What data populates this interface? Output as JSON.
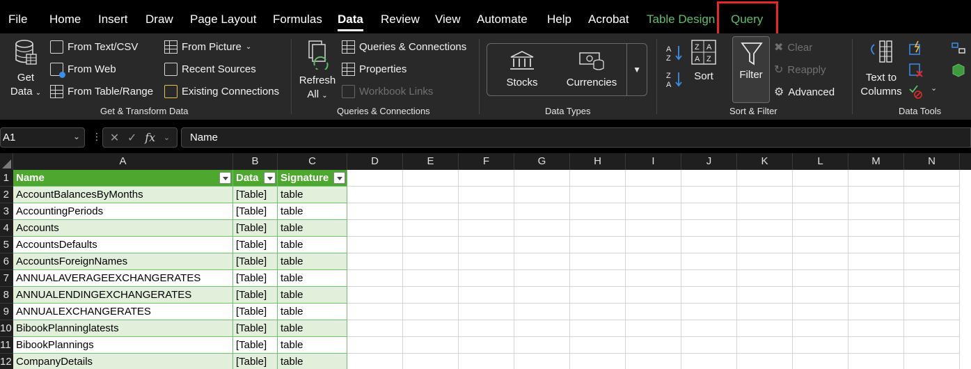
{
  "menu": {
    "tabs": [
      {
        "label": "File"
      },
      {
        "label": "Home"
      },
      {
        "label": "Insert"
      },
      {
        "label": "Draw"
      },
      {
        "label": "Page Layout"
      },
      {
        "label": "Formulas"
      },
      {
        "label": "Data"
      },
      {
        "label": "Review"
      },
      {
        "label": "View"
      },
      {
        "label": "Automate"
      },
      {
        "label": "Help"
      },
      {
        "label": "Acrobat"
      },
      {
        "label": "Table Design"
      },
      {
        "label": "Query"
      }
    ],
    "active_tab": "Data",
    "highlight_color": "#e4282a",
    "contextual_color": "#5fbe6a"
  },
  "ribbon": {
    "get_transform": {
      "get_data_line1": "Get",
      "get_data_line2": "Data",
      "from_text_csv": "From Text/CSV",
      "from_web": "From Web",
      "from_table_range": "From Table/Range",
      "from_picture": "From Picture",
      "recent_sources": "Recent Sources",
      "existing_connections": "Existing Connections",
      "group_label": "Get & Transform Data"
    },
    "queries_connections": {
      "refresh_line1": "Refresh",
      "refresh_line2": "All",
      "queries_connections": "Queries & Connections",
      "properties": "Properties",
      "workbook_links": "Workbook Links",
      "group_label": "Queries & Connections"
    },
    "data_types": {
      "stocks": "Stocks",
      "currencies": "Currencies",
      "group_label": "Data Types"
    },
    "sort_filter": {
      "sort": "Sort",
      "filter": "Filter",
      "clear": "Clear",
      "reapply": "Reapply",
      "advanced": "Advanced",
      "group_label": "Sort & Filter"
    },
    "data_tools": {
      "text_to_columns_line1": "Text to",
      "text_to_columns_line2": "Columns",
      "group_label": "Data Tools"
    }
  },
  "formula_bar": {
    "name_box": "A1",
    "fx": "fx",
    "formula": "Name"
  },
  "sheet": {
    "columns": [
      "A",
      "B",
      "C",
      "D",
      "E",
      "F",
      "G",
      "H",
      "I",
      "J",
      "K",
      "L",
      "M",
      "N"
    ],
    "row_numbers": [
      "1",
      "2",
      "3",
      "4",
      "5",
      "6",
      "7",
      "8",
      "9",
      "10",
      "11",
      "12"
    ],
    "table_header": [
      "Name",
      "Data",
      "Signature"
    ],
    "table_rows": [
      [
        "AccountBalancesByMonths",
        "[Table]",
        "table"
      ],
      [
        "AccountingPeriods",
        "[Table]",
        "table"
      ],
      [
        "Accounts",
        "[Table]",
        "table"
      ],
      [
        "AccountsDefaults",
        "[Table]",
        "table"
      ],
      [
        "AccountsForeignNames",
        "[Table]",
        "table"
      ],
      [
        "ANNUALAVERAGEEXCHANGERATES",
        "[Table]",
        "table"
      ],
      [
        "ANNUALENDINGEXCHANGERATES",
        "[Table]",
        "table"
      ],
      [
        "ANNUALEXCHANGERATES",
        "[Table]",
        "table"
      ],
      [
        "BibookPlanninglatests",
        "[Table]",
        "table"
      ],
      [
        "BibookPlannings",
        "[Table]",
        "table"
      ],
      [
        "CompanyDetails",
        "[Table]",
        "table"
      ]
    ],
    "header_color": "#4ea72e",
    "band_color": "#e2efda"
  }
}
